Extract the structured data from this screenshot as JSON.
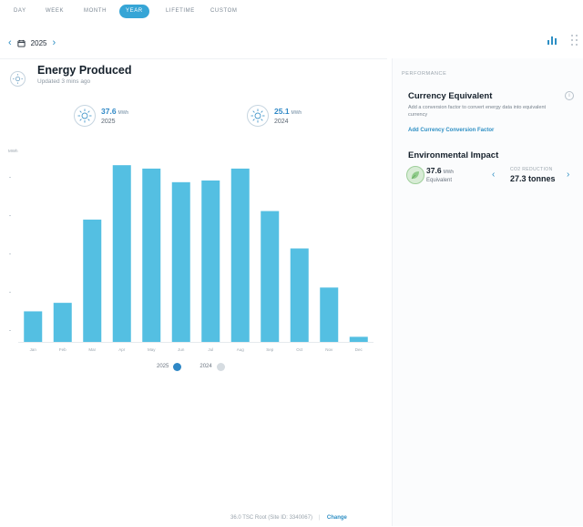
{
  "tabs": [
    {
      "label": "DAY",
      "active": false
    },
    {
      "label": "WEEK",
      "active": false
    },
    {
      "label": "MONTH",
      "active": false
    },
    {
      "label": "YEAR",
      "active": true
    },
    {
      "label": "LIFETIME",
      "active": false
    },
    {
      "label": "CUSTOM",
      "active": false
    }
  ],
  "date_nav": {
    "year": "2025"
  },
  "energy_card": {
    "title": "Energy Produced",
    "updated": "Updated 3 mins ago",
    "stat_current": {
      "value": "37.6",
      "unit": "MWh",
      "year": "2025"
    },
    "stat_previous": {
      "value": "25.1",
      "unit": "MWh",
      "year": "2024"
    },
    "y_unit": "MWh"
  },
  "legend": {
    "current": "2025",
    "previous": "2024"
  },
  "chart_data": {
    "type": "bar",
    "categories": [
      "Jan",
      "Feb",
      "Mar",
      "Apr",
      "May",
      "Jun",
      "Jul",
      "Aug",
      "Sep",
      "Oct",
      "Nov",
      "Dec"
    ],
    "series": [
      {
        "name": "2025",
        "values": [
          1.8,
          2.3,
          7.2,
          10.4,
          10.2,
          9.4,
          9.5,
          10.2,
          7.7,
          5.5,
          3.2,
          0.3
        ]
      }
    ],
    "ylim": [
      0,
      11
    ],
    "colors": {
      "2025": "#54bfe2",
      "2024": "#d6dce1"
    }
  },
  "footer": {
    "system_text": "36.0 TSC Root (Site ID: 3340067)",
    "separator": "|",
    "link": "Change"
  },
  "right_panel": {
    "section_label": "PERFORMANCE",
    "currency": {
      "title": "Currency Equivalent",
      "desc": "Add a conversion factor to convert energy data into equivalent currency",
      "link": "Add Currency Conversion Factor"
    },
    "environment": {
      "title": "Environmental Impact",
      "value": "37.6",
      "unit": "MWh",
      "equivalent": "Equivalent",
      "co2_label": "CO2 REDUCTION",
      "co2_value": "27.3 tonnes"
    }
  },
  "icons": [
    "calendar-icon",
    "bar-chart-icon",
    "grid-view-icon",
    "sun-icon",
    "leaf-icon",
    "info-icon"
  ]
}
